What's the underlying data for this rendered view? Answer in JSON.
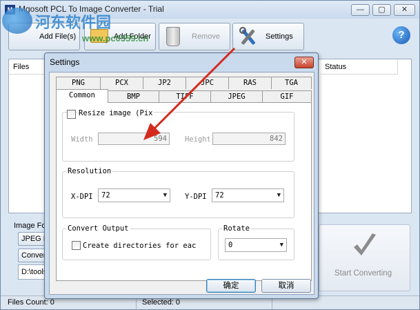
{
  "window": {
    "title": "Mgosoft PCL To Image Converter - Trial",
    "app_icon_text": "M",
    "minimize": "—",
    "maximize": "▢",
    "close": "✕"
  },
  "watermark": {
    "text": "河东软件园",
    "url": "www.pc0359.cn"
  },
  "toolbar": {
    "add_files": "Add File(s)",
    "add_folder": "Add Folder",
    "remove": "Remove",
    "settings": "Settings",
    "help": "?"
  },
  "file_list": {
    "columns": [
      "Files",
      "Status"
    ]
  },
  "bottom": {
    "image_format_label": "Image Fo",
    "jpeg_button": "JPEG Fil",
    "convert_button": "Conver",
    "output_path": "D:\\tools",
    "start_converting": "Start Converting"
  },
  "statusbar": {
    "files_count": "Files Count: 0",
    "selected": "Selected: 0"
  },
  "dialog": {
    "title": "Settings",
    "close": "✕",
    "tabs_row1": [
      "PNG",
      "PCX",
      "JP2",
      "JPC",
      "RAS",
      "TGA"
    ],
    "tabs_row2": [
      "Common",
      "BMP",
      "TIFF",
      "JPEG",
      "GIF"
    ],
    "active_tab": "Common",
    "resize_label": "Resize image (Pix",
    "width_label": "Width",
    "width_value": "594",
    "height_label": "Height",
    "height_value": "842",
    "resolution_label": "Resolution",
    "xdpi_label": "X-DPI",
    "xdpi_value": "72",
    "ydpi_label": "Y-DPI",
    "ydpi_value": "72",
    "convert_output_label": "Convert Output",
    "create_dirs_label": "Create directories for eac",
    "rotate_label": "Rotate",
    "rotate_value": "0",
    "ok": "确定",
    "cancel": "取消"
  },
  "annotation": {
    "arrow_color": "#d42a1e"
  }
}
